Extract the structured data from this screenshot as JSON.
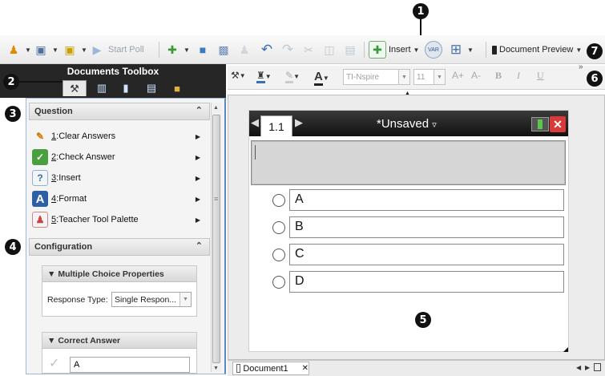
{
  "callouts": [
    "1",
    "2",
    "3",
    "4",
    "5",
    "6",
    "7"
  ],
  "main_toolbar": {
    "start_poll_label": "Start Poll",
    "insert_label": "Insert",
    "vars_label": "VAR",
    "document_preview_label": "Document Preview",
    "overflow": "»"
  },
  "toolbox": {
    "title": "Documents Toolbox",
    "question": {
      "header": "Question",
      "collapse": "⌃",
      "items": [
        {
          "number": "1",
          "label": "Clear Answers"
        },
        {
          "number": "2",
          "label": "Check Answer"
        },
        {
          "number": "3",
          "label": "Insert"
        },
        {
          "number": "4",
          "label": "Format"
        },
        {
          "number": "5",
          "label": "Teacher Tool Palette"
        }
      ]
    },
    "configuration": {
      "header": "Configuration",
      "collapse": "⌃",
      "mc_properties_header": "Multiple Choice Properties",
      "response_type_label": "Response Type:",
      "response_type_value": "Single Respon...",
      "correct_answer_header": "Correct Answer",
      "correct_answer_value": "A"
    }
  },
  "format_toolbar": {
    "font": "TI-Nspire",
    "size": "11",
    "bigger": "A+",
    "smaller": "A-",
    "bold": "B",
    "italic": "I",
    "underline": "U"
  },
  "document": {
    "page_number": "1.1",
    "name": "*Unsaved",
    "choices": [
      "A",
      "B",
      "C",
      "D"
    ]
  },
  "bottom": {
    "tab_label": "Document1",
    "tab_close": "✕"
  },
  "colors": {
    "toolbox_header": "#262626",
    "accent_blue": "#5a8ac2",
    "title_bar": "#111111"
  }
}
